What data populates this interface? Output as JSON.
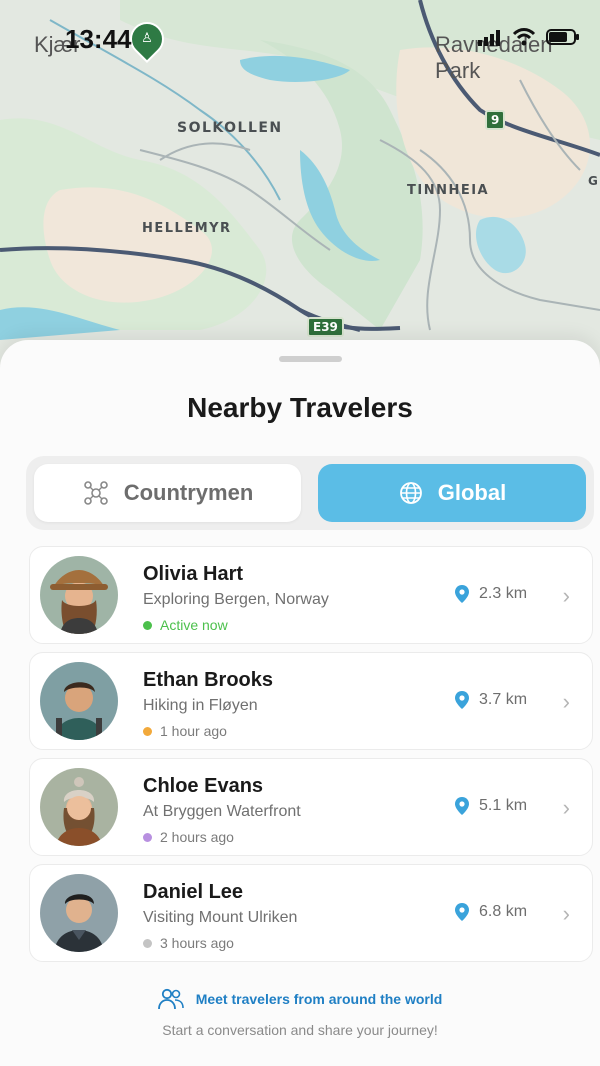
{
  "status_bar": {
    "time": "13:44",
    "map_place_left": "Kjær",
    "map_place_right": "Ravnedalen Park"
  },
  "map": {
    "labels": [
      "SOLKOLLEN",
      "TINNHEIA",
      "HELLEMYR",
      "G"
    ],
    "road_shields": [
      "9",
      "E39"
    ]
  },
  "sheet": {
    "title": "Nearby Travelers",
    "tabs": [
      {
        "label": "Countrymen",
        "icon": "people-network-icon",
        "selected": false
      },
      {
        "label": "Global",
        "icon": "globe-icon",
        "selected": true
      }
    ],
    "accent": "#5bbde6",
    "travelers": [
      {
        "name": "Olivia Hart",
        "activity": "Exploring Bergen, Norway",
        "status": "Active now",
        "status_color": "#4cc04c",
        "distance": "2.3 km"
      },
      {
        "name": "Ethan Brooks",
        "activity": "Hiking in Fløyen",
        "status": "1 hour ago",
        "status_color": "#f2a93b",
        "distance": "3.7 km"
      },
      {
        "name": "Chloe Evans",
        "activity": "At Bryggen Waterfront",
        "status": "2 hours ago",
        "status_color": "#b890e0",
        "distance": "5.1 km"
      },
      {
        "name": "Daniel Lee",
        "activity": "Visiting Mount Ulriken",
        "status": "3 hours ago",
        "status_color": "#c4c4c4",
        "distance": "6.8 km"
      }
    ],
    "footer_title": "Meet travelers from around the world",
    "footer_subtitle": "Start a conversation and share your journey!"
  }
}
